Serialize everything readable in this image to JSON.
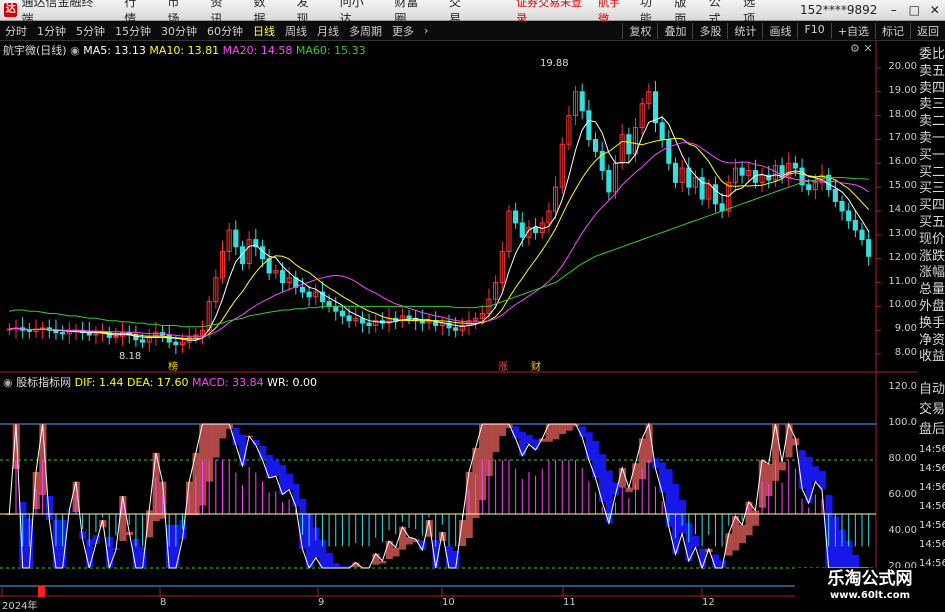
{
  "menubar": {
    "app_name": "通达信金融终端",
    "items": [
      "行情",
      "市场",
      "资讯",
      "数据",
      "发现",
      "问小达",
      "财富圈",
      "交易"
    ],
    "warning": "证券交易未登录",
    "stock": "航宇微",
    "right_items": [
      "功能",
      "版面",
      "公式",
      "选项"
    ],
    "user": "152****9892"
  },
  "toolbar": {
    "periods": [
      "分时",
      "1分钟",
      "5分钟",
      "15分钟",
      "30分钟",
      "60分钟",
      "日线",
      "周线",
      "月线",
      "多周期",
      "更多"
    ],
    "active": "日线",
    "right": [
      "复权",
      "叠加",
      "多股",
      "统计",
      "画线",
      "F10",
      "+自选",
      "标记",
      "返回"
    ]
  },
  "main_info": {
    "title": "航宇微(日线)",
    "ma5": "MA5: 13.13",
    "ma10": "MA10: 13.81",
    "ma20": "MA20: 14.58",
    "ma60": "MA60: 15.33"
  },
  "sub_info": {
    "title": "股标指标网",
    "dif": "DIF: 1.44",
    "dea": "DEA: 17.60",
    "macd": "MACD: 33.84",
    "wr": "WR: 0.00"
  },
  "price_axis": [
    "20.00",
    "19.00",
    "18.00",
    "17.00",
    "16.00",
    "15.00",
    "14.00",
    "13.00",
    "12.00",
    "11.00",
    "10.00",
    "9.00",
    "8.00"
  ],
  "sub_axis": [
    "120.0",
    "100.0",
    "80.00",
    "60.00",
    "40.00",
    "20.00"
  ],
  "annotations": {
    "high": "19.88",
    "low": "8.18",
    "m1": "榜",
    "m2": "涨",
    "m3": "财"
  },
  "side_labels": [
    "委比",
    "卖五",
    "卖四",
    "卖三",
    "卖二",
    "卖一",
    "买一",
    "买二",
    "买三",
    "买四",
    "买五",
    "现价",
    "涨跌",
    "涨幅",
    "总量",
    "外盘",
    "换手",
    "净资",
    "收益",
    "自动",
    "交易",
    "盘后"
  ],
  "side_times": [
    "14:56",
    "14:56",
    "14:56",
    "14:56",
    "14:56",
    "14:56",
    "14:56"
  ],
  "dates": [
    "2024年",
    "8",
    "9",
    "10",
    "11",
    "12"
  ],
  "watermark": {
    "line1": "乐淘公式网",
    "line2": "www.60lt.com"
  },
  "colors": {
    "up": "#ff3333",
    "down": "#33e0e0",
    "ma5": "#ffffff",
    "ma10": "#ffff00",
    "ma20": "#ff44ff",
    "ma60": "#33cc33"
  },
  "chart_data": {
    "type": "candlestick",
    "ylim": [
      7.5,
      20.5
    ],
    "closes": [
      9.05,
      9.1,
      9.0,
      8.95,
      9.05,
      9.1,
      9.0,
      8.9,
      8.85,
      8.95,
      9.0,
      8.9,
      8.8,
      8.85,
      8.9,
      8.7,
      8.75,
      8.9,
      8.8,
      8.6,
      8.5,
      8.7,
      8.9,
      8.8,
      8.5,
      8.4,
      8.5,
      8.7,
      8.8,
      9.0,
      10.2,
      11.2,
      12.3,
      13.2,
      12.5,
      11.8,
      12.8,
      12.5,
      12.0,
      11.4,
      11.5,
      11.0,
      11.2,
      10.8,
      10.6,
      10.4,
      10.6,
      10.2,
      10.0,
      9.8,
      9.6,
      9.4,
      9.5,
      9.3,
      9.2,
      9.4,
      9.3,
      9.5,
      9.4,
      9.6,
      9.5,
      9.4,
      9.3,
      9.4,
      9.2,
      9.3,
      9.1,
      9.0,
      9.2,
      9.4,
      9.5,
      9.7,
      10.3,
      11.0,
      12.3,
      14.0,
      13.5,
      12.9,
      13.3,
      13.1,
      13.5,
      14.0,
      15.0,
      16.8,
      18.0,
      19.0,
      18.2,
      17.0,
      16.5,
      15.7,
      14.8,
      16.0,
      17.2,
      16.4,
      17.5,
      18.5,
      19.0,
      17.7,
      17.0,
      16.0,
      15.2,
      15.8,
      15.0,
      15.4,
      14.5,
      15.1,
      14.3,
      14.0,
      15.2,
      15.8,
      15.5,
      15.7,
      15.2,
      15.5,
      15.3,
      15.9,
      15.4,
      16.0,
      15.8,
      15.1,
      14.9,
      15.2,
      15.5,
      14.9,
      14.4,
      14.0,
      13.6,
      13.2,
      12.8,
      12.1
    ],
    "ma60": [
      9.8,
      9.85,
      9.85,
      9.8,
      9.8,
      9.75,
      9.7,
      9.7,
      9.65,
      9.6,
      9.6,
      9.55,
      9.5,
      9.5,
      9.45,
      9.4,
      9.4,
      9.35,
      9.35,
      9.3,
      9.3,
      9.25,
      9.25,
      9.2,
      9.2,
      9.2,
      9.15,
      9.15,
      9.15,
      9.15,
      9.2,
      9.25,
      9.3,
      9.4,
      9.45,
      9.5,
      9.6,
      9.65,
      9.7,
      9.75,
      9.8,
      9.85,
      9.85,
      9.9,
      9.9,
      9.95,
      9.95,
      10.0,
      10.0,
      10.0,
      10.0,
      10.0,
      10.0,
      10.0,
      10.0,
      10.0,
      10.0,
      10.0,
      10.0,
      10.0,
      10.0,
      10.0,
      10.0,
      10.0,
      10.0,
      10.0,
      10.0,
      9.95,
      9.95,
      9.95,
      9.95,
      10.0,
      10.0,
      10.1,
      10.2,
      10.3,
      10.4,
      10.5,
      10.6,
      10.7,
      10.8,
      10.9,
      11.0,
      11.2,
      11.4,
      11.6,
      11.8,
      11.95,
      12.1,
      12.2,
      12.3,
      12.4,
      12.5,
      12.6,
      12.7,
      12.8,
      12.9,
      13.0,
      13.1,
      13.2,
      13.3,
      13.4,
      13.5,
      13.6,
      13.7,
      13.8,
      13.9,
      14.0,
      14.1,
      14.2,
      14.3,
      14.4,
      14.5,
      14.6,
      14.7,
      14.8,
      14.9,
      15.0,
      15.1,
      15.2,
      15.25,
      15.3,
      15.35,
      15.4,
      15.4,
      15.4,
      15.38,
      15.36,
      15.35,
      15.33
    ]
  }
}
